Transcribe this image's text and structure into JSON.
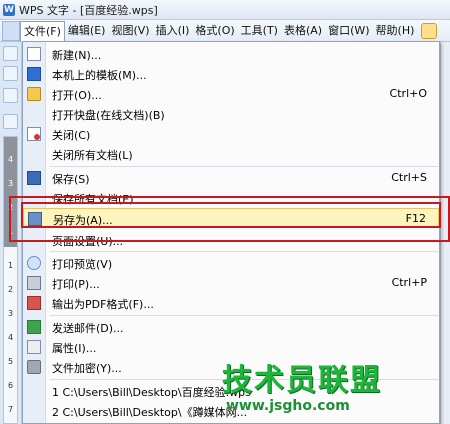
{
  "window": {
    "title": "WPS 文字 - [百度经验.wps]",
    "app_icon_letter": "W"
  },
  "menubar": {
    "items": [
      "文件(F)",
      "编辑(E)",
      "视图(V)",
      "插入(I)",
      "格式(O)",
      "工具(T)",
      "表格(A)",
      "窗口(W)",
      "帮助(H)"
    ],
    "active_index": 0
  },
  "ruler": {
    "numbers": [
      "4",
      "3",
      "2",
      "1",
      "1",
      "2",
      "3",
      "4",
      "5",
      "6",
      "7"
    ]
  },
  "file_menu": {
    "items": [
      {
        "label": "新建(N)...",
        "shortcut": "",
        "icon": "new-doc-icon"
      },
      {
        "label": "本机上的模板(M)...",
        "shortcut": "",
        "icon": "template-icon"
      },
      {
        "label": "打开(O)...",
        "shortcut": "Ctrl+O",
        "icon": "open-folder-icon"
      },
      {
        "label": "打开快盘(在线文档)(B)",
        "shortcut": "",
        "icon": ""
      },
      {
        "label": "关闭(C)",
        "shortcut": "",
        "icon": "close-doc-icon"
      },
      {
        "label": "关闭所有文档(L)",
        "shortcut": "",
        "icon": ""
      },
      {
        "label": "保存(S)",
        "shortcut": "Ctrl+S",
        "icon": "save-icon"
      },
      {
        "label": "保存所有文档(E)",
        "shortcut": "",
        "icon": ""
      },
      {
        "label": "另存为(A)...",
        "shortcut": "F12",
        "icon": "save-as-icon"
      },
      {
        "label": "页面设置(U)...",
        "shortcut": "",
        "icon": ""
      },
      {
        "label": "打印预览(V)",
        "shortcut": "",
        "icon": "print-preview-icon"
      },
      {
        "label": "打印(P)...",
        "shortcut": "Ctrl+P",
        "icon": "print-icon"
      },
      {
        "label": "输出为PDF格式(F)...",
        "shortcut": "",
        "icon": "pdf-icon"
      },
      {
        "label": "发送邮件(D)...",
        "shortcut": "",
        "icon": "send-mail-icon"
      },
      {
        "label": "属性(I)...",
        "shortcut": "",
        "icon": "properties-icon"
      },
      {
        "label": "文件加密(Y)...",
        "shortcut": "",
        "icon": "encrypt-icon"
      },
      {
        "label": "1 C:\\Users\\Bill\\Desktop\\百度经验.wps",
        "shortcut": "",
        "icon": ""
      },
      {
        "label": "2 C:\\Users\\Bill\\Desktop\\《蹲媒体网...",
        "shortcut": "",
        "icon": ""
      }
    ],
    "highlighted_index": 8
  },
  "watermark": {
    "title": "技术员联盟",
    "url": "www.jsgho.com"
  },
  "colors": {
    "highlight": "#fdf3bd",
    "annotation_red": "#c8191f",
    "watermark_green": "#1eb53a"
  }
}
